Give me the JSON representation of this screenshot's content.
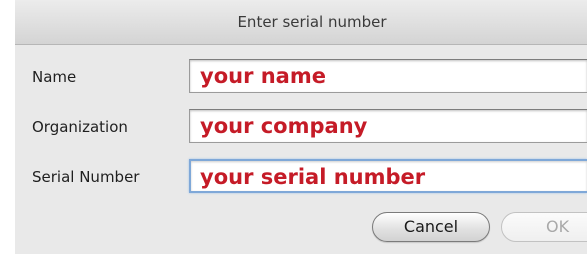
{
  "dialog": {
    "title": "Enter serial number"
  },
  "form": {
    "name": {
      "label": "Name",
      "value": "your name"
    },
    "organization": {
      "label": "Organization",
      "value": "your company"
    },
    "serial": {
      "label": "Serial Number",
      "value": "your serial number"
    }
  },
  "buttons": {
    "cancel_label": "Cancel",
    "ok_label": "OK"
  },
  "colors": {
    "field_text": "#c51b27",
    "focus_ring": "#7fa8d8",
    "dialog_background": "#e9e9e9"
  }
}
